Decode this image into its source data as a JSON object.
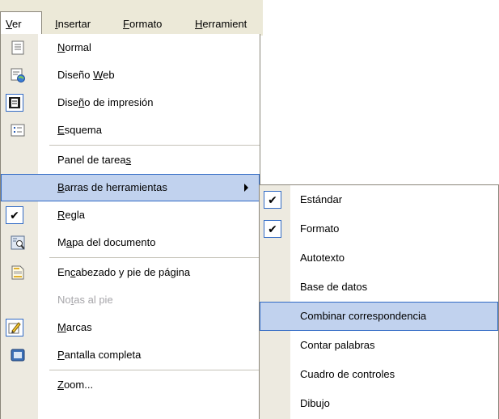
{
  "menubar": {
    "items": [
      {
        "label": "Ver",
        "accel": "V"
      },
      {
        "label": "Insertar",
        "accel": "I"
      },
      {
        "label": "Formato",
        "accel": "F"
      },
      {
        "label": "Herramient",
        "accel": "H"
      }
    ]
  },
  "menu": {
    "items": [
      {
        "pre": "",
        "accel": "N",
        "post": "ormal",
        "icon": "normal-view-icon"
      },
      {
        "pre": "Diseño ",
        "accel": "W",
        "post": "eb",
        "icon": "web-layout-icon"
      },
      {
        "pre": "Dise",
        "accel": "ñ",
        "post": "o de impresión",
        "icon": "print-layout-icon"
      },
      {
        "pre": "",
        "accel": "E",
        "post": "squema",
        "icon": "outline-view-icon"
      },
      {
        "pre": "Panel de tarea",
        "accel": "s",
        "post": ""
      },
      {
        "pre": "",
        "accel": "B",
        "post": "arras de herramientas",
        "submenu": true
      },
      {
        "pre": "",
        "accel": "R",
        "post": "egla",
        "checked": true
      },
      {
        "pre": "M",
        "accel": "a",
        "post": "pa del documento",
        "icon": "document-map-icon"
      },
      {
        "pre": "En",
        "accel": "c",
        "post": "abezado y pie de página",
        "icon": "header-footer-icon"
      },
      {
        "pre": "No",
        "accel": "t",
        "post": "as al pie",
        "disabled": true
      },
      {
        "pre": "",
        "accel": "M",
        "post": "arcas",
        "icon": "markup-icon"
      },
      {
        "pre": "",
        "accel": "P",
        "post": "antalla completa",
        "icon": "full-screen-icon"
      },
      {
        "pre": "",
        "accel": "Z",
        "post": "oom..."
      }
    ]
  },
  "submenu": {
    "items": [
      {
        "label": "Estándar",
        "checked": true
      },
      {
        "label": "Formato",
        "checked": true
      },
      {
        "label": "Autotexto"
      },
      {
        "label": "Base de datos"
      },
      {
        "label": "Combinar correspondencia",
        "highlighted": true
      },
      {
        "label": "Contar palabras"
      },
      {
        "label": "Cuadro de controles"
      },
      {
        "label": "Dibujo"
      }
    ]
  },
  "colors": {
    "gutter": "#edeae0",
    "highlight": "#c1d2ee",
    "highlight_border": "#316ac5",
    "menubar": "#ece9d8",
    "disabled_text": "#a7a6aa"
  }
}
